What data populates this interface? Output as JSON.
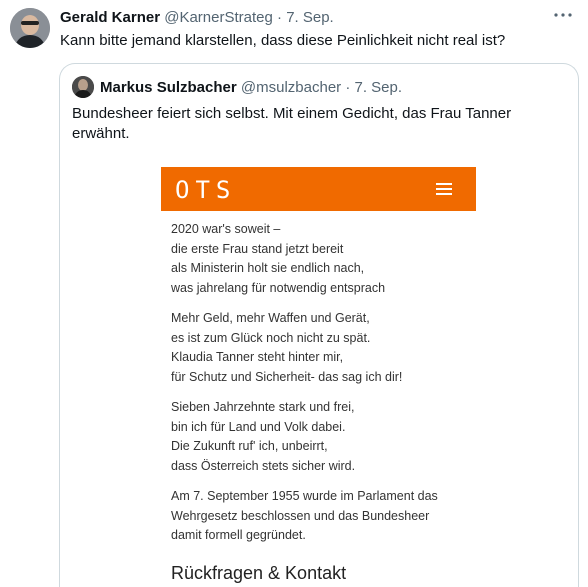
{
  "tweet": {
    "author_name": "Gerald Karner",
    "handle": "@KarnerStrateg",
    "separator": " · ",
    "date": "7. Sep.",
    "text": "Kann bitte jemand klarstellen, dass diese Peinlichkeit nicht real ist?",
    "more_icon": "more-horizontal-icon"
  },
  "quote": {
    "author_name": "Markus Sulzbacher",
    "handle": "@msulzbacher",
    "separator": " · ",
    "date": "7. Sep.",
    "text": "Bundesheer feiert sich selbst. Mit einem Gedicht, das Frau Tanner erwähnt."
  },
  "ots": {
    "logo": "OTS",
    "accent_color": "#f06a00",
    "menu_icon": "hamburger-menu-icon",
    "stanzas": [
      [
        "2020 war's soweit –",
        "die erste Frau stand jetzt bereit",
        "als Ministerin holt sie endlich nach,",
        "was jahrelang für notwendig entsprach"
      ],
      [
        "Mehr Geld, mehr Waffen und Gerät,",
        "es ist zum Glück noch nicht zu spät.",
        "Klaudia Tanner steht hinter mir,",
        "für Schutz und Sicherheit- das sag ich dir!"
      ],
      [
        "Sieben Jahrzehnte stark und frei,",
        "bin ich für Land und Volk dabei.",
        "Die Zukunft ruf' ich, unbeirrt,",
        "dass Österreich stets sicher wird."
      ],
      [
        "Am 7. September 1955 wurde im Parlament das",
        "Wehrgesetz beschlossen und das Bundesheer",
        "damit formell gegründet."
      ]
    ],
    "contact_heading": "Rückfragen & Kontakt"
  }
}
